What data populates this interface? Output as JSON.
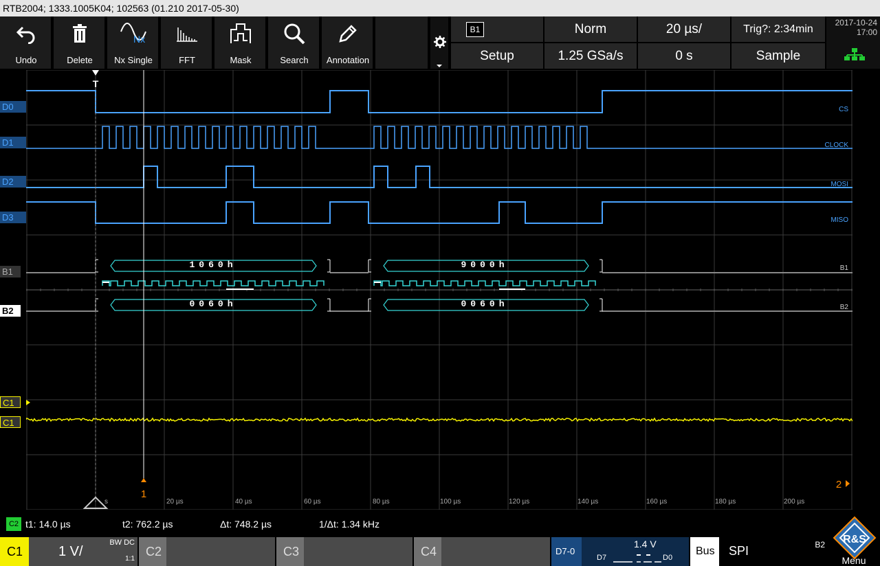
{
  "title": "RTB2004; 1333.1005K04; 102563 (01.210 2017-05-30)",
  "toolbar": [
    {
      "label": "Undo",
      "icon": "undo-icon"
    },
    {
      "label": "Delete",
      "icon": "trash-icon"
    },
    {
      "label": "Nx Single",
      "icon": "nx-single-icon",
      "glyph": "Nx"
    },
    {
      "label": "FFT",
      "icon": "fft-icon"
    },
    {
      "label": "Mask",
      "icon": "mask-icon"
    },
    {
      "label": "Search",
      "icon": "search-icon"
    },
    {
      "label": "Annotation",
      "icon": "pencil-icon"
    }
  ],
  "settings": {
    "bus_badge": "B1",
    "trigger_mode": "Norm",
    "timebase": "20 µs/",
    "trigger_status": "Trig?: 2:34min",
    "setup": "Setup",
    "sample_rate": "1.25 GSa/s",
    "offset": "0 s",
    "acq_mode": "Sample",
    "date": "2017-10-24",
    "time": "17:00"
  },
  "channels": {
    "digital": [
      {
        "label": "D0",
        "name": "CS"
      },
      {
        "label": "D1",
        "name": "CLOCK"
      },
      {
        "label": "D2",
        "name": "MOSI"
      },
      {
        "label": "D3",
        "name": "MISO"
      }
    ],
    "bus1": {
      "label": "B1",
      "right": "B1"
    },
    "bus2": {
      "label": "B2",
      "right": "B2"
    },
    "c1_trig": "C1",
    "c1": "C1",
    "trigger_marker": "T",
    "cursor_marker": "1",
    "ref_marker": "2"
  },
  "decode": {
    "b1_frames": [
      "1060h",
      "9000h"
    ],
    "b2_frames": [
      "0060h",
      "0060h"
    ]
  },
  "xaxis": {
    "first": "s",
    "ticks": [
      "20 µs",
      "40 µs",
      "60 µs",
      "80 µs",
      "100 µs",
      "120 µs",
      "140 µs",
      "160 µs",
      "180 µs",
      "200 µs"
    ]
  },
  "cursors": {
    "badge": "C2",
    "t1": "t1: 14.0 µs",
    "t2": "t2: 762.2 µs",
    "dt": "Δt: 748.2 µs",
    "inv_dt": "1/Δt: 1.34 kHz"
  },
  "bottom": {
    "c1": "C1",
    "c1_scale": "1 V/",
    "c1_bw": "BW DC",
    "c1_ratio": "1:1",
    "c2": "C2",
    "c3": "C3",
    "c4": "C4",
    "d70": "D7-0",
    "d_level": "1.4 V",
    "d7": "D7",
    "d0": "D0",
    "bus": "Bus",
    "protocol": "SPI",
    "bus_id": "B2",
    "menu": "Menu"
  },
  "colors": {
    "digital": "#4aa3ff",
    "bus": "#36d6d6",
    "c1": "#f5f000",
    "cursor_badge": "#22cc33"
  }
}
